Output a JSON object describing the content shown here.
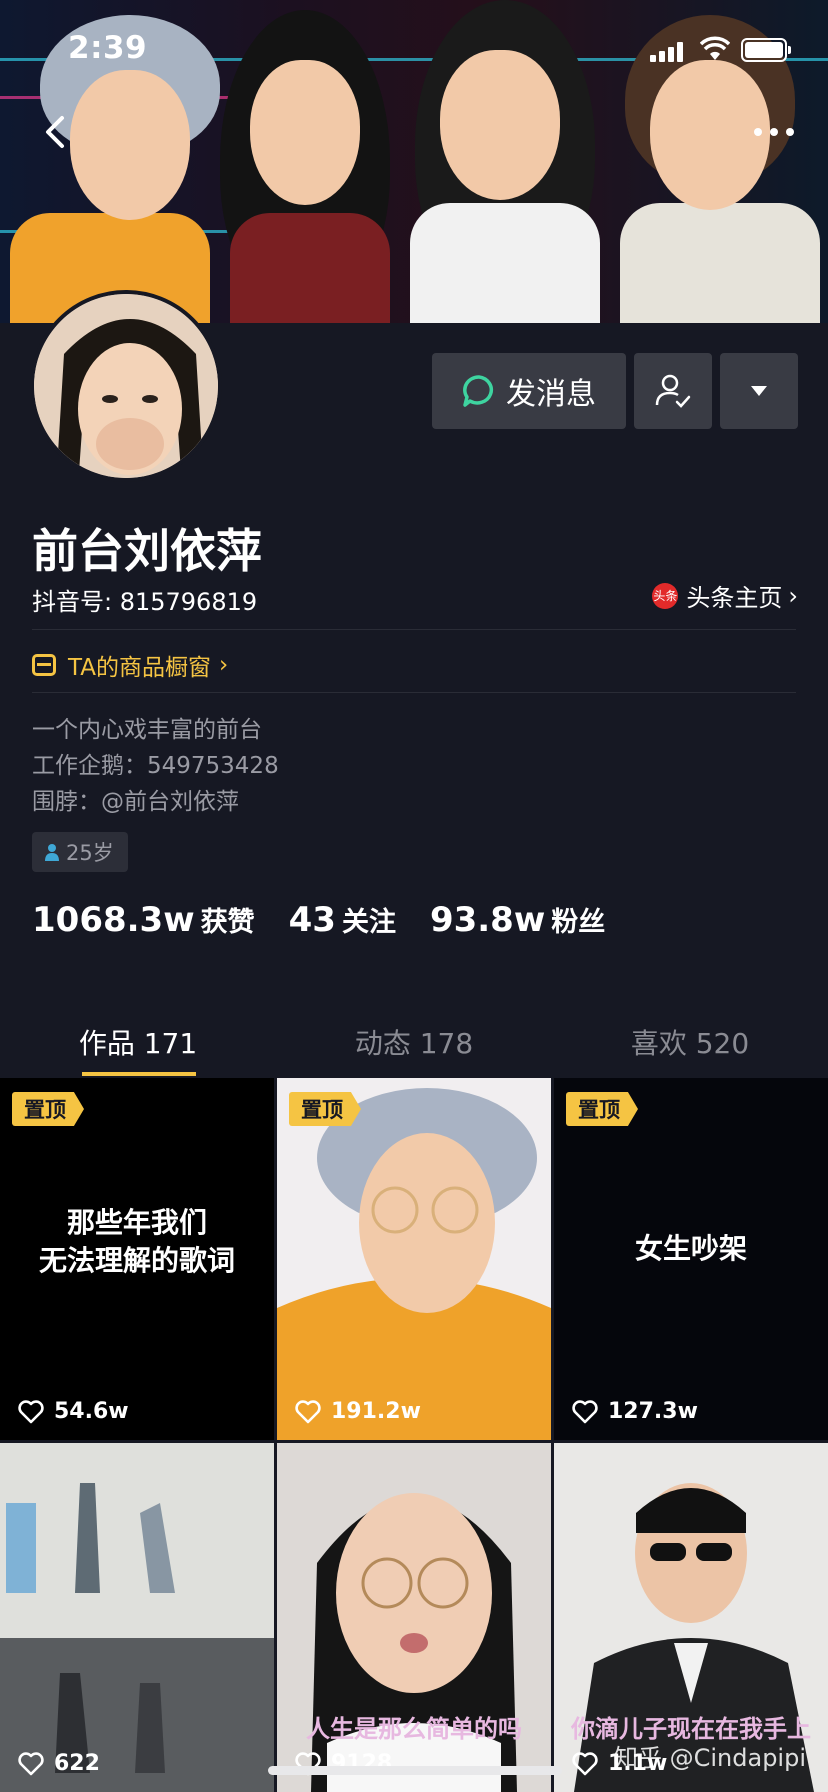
{
  "status_bar": {
    "time": "2:39"
  },
  "profile": {
    "nickname": "前台刘依萍",
    "douyin_id": "抖音号: 815796819",
    "toutiao_label": "头条主页",
    "toutiao_badge": "头条",
    "shop_label": "TA的商品橱窗",
    "bio": [
      "一个内心戏丰富的前台",
      "工作企鹅：549753428",
      "围脖：@前台刘依萍"
    ],
    "age": "25岁"
  },
  "actions": {
    "message_label": "发消息"
  },
  "stats": [
    {
      "value": "1068.3w",
      "label": "获赞"
    },
    {
      "value": "43",
      "label": "关注"
    },
    {
      "value": "93.8w",
      "label": "粉丝"
    }
  ],
  "tabs": [
    {
      "label": "作品 171",
      "active": true
    },
    {
      "label": "动态 178",
      "active": false
    },
    {
      "label": "喜欢 520",
      "active": false
    }
  ],
  "videos": [
    {
      "pinned": "置顶",
      "cover_text": [
        "那些年我们",
        "无法理解的歌词"
      ],
      "likes": "54.6w"
    },
    {
      "pinned": "置顶",
      "likes": "191.2w"
    },
    {
      "pinned": "置顶",
      "cover_text": [
        "女生吵架"
      ],
      "likes": "127.3w"
    },
    {
      "likes": "622"
    },
    {
      "caption": "人生是那么简单的吗",
      "likes": "9128"
    },
    {
      "caption": "你滴儿子现在在我手上",
      "likes": "1.1w"
    }
  ],
  "watermark": "知乎 @Cindapipi",
  "colors": {
    "accent": "#f5c443",
    "background": "#161823",
    "button": "#393b44"
  }
}
